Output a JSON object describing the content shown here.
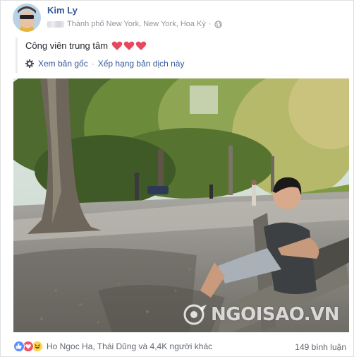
{
  "post": {
    "author": "Kim Ly",
    "location": "Thành phố New York, New York, Hoa Kỳ",
    "separator": "·",
    "caption": "Công viên trung tâm",
    "caption_hearts": 3,
    "see_original": "Xem bản gốc",
    "rate_translation": "Xếp hạng bản dịch này",
    "translate_dot": "·"
  },
  "photo": {
    "watermark": "NGOISAO.VN"
  },
  "footer": {
    "reactions": [
      "like-icon",
      "love-icon",
      "haha-icon"
    ],
    "reaction_names": "Ho Ngoc Ha, Thái Dũng và 4,4K người khác",
    "comments": "149 bình luận"
  },
  "colors": {
    "link_blue": "#365899",
    "like_blue": "#5890ff",
    "love_red": "#f25268",
    "haha_yellow": "#fcd24d",
    "heart_pink": "#e8475e"
  }
}
